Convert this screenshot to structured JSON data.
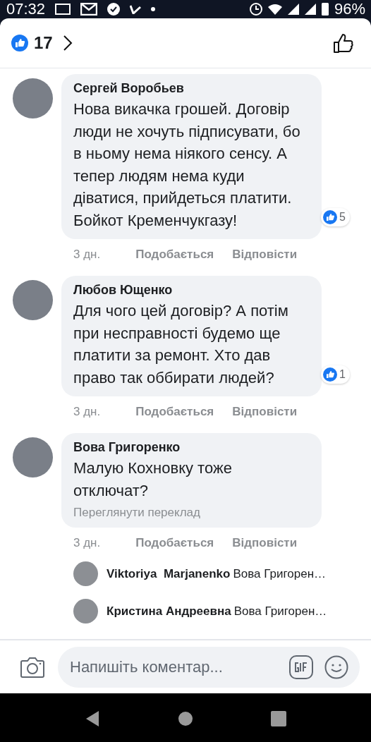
{
  "status_bar": {
    "time": "07:32",
    "battery": "96%"
  },
  "header": {
    "reaction_count": "17"
  },
  "comments": [
    {
      "author": "Сергей Воробьев",
      "text": "Нова викачка грошей. Договір люди не хочуть підписувати, бо в ньому нема ніякого сенсу. А тепер людям нема куди діватися, прийдеться платити. Бойкот Кременчукгазу!",
      "reactions": "5",
      "time": "3 дн.",
      "like": "Подобається",
      "reply": "Відповісти"
    },
    {
      "author": "Любов Ющенко",
      "text": "Для чого цей договір? А потім при несправності будемо ще платити за ремонт. Хто дав право так оббирати людей?",
      "reactions": "1",
      "time": "3 дн.",
      "like": "Подобається",
      "reply": "Відповісти"
    },
    {
      "author": "Вова Григоренко",
      "text": "Малую Кохновку тоже отключат?",
      "translate": "Переглянути переклад",
      "time": "3 дн.",
      "like": "Подобається",
      "reply": "Відповісти",
      "replies": [
        {
          "author": "Viktoriya  Marjanenko",
          "text": "Вова Григорен…"
        },
        {
          "author": "Кристина Андреевна",
          "text": "Вова Григорен…"
        }
      ]
    }
  ],
  "composer": {
    "placeholder": "Напишіть коментар..."
  }
}
